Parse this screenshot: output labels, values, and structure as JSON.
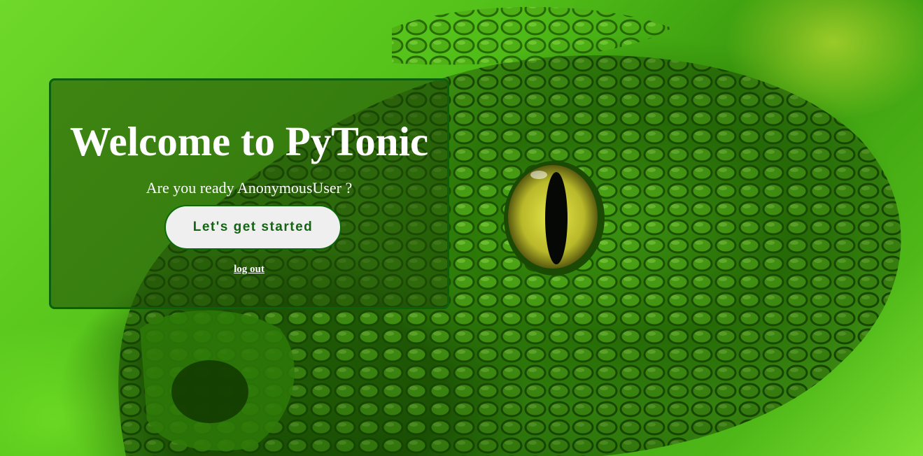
{
  "background": {
    "image": "green-snake-photo"
  },
  "card": {
    "title": "Welcome to PyTonic",
    "greeting": "Are you ready AnonymousUser ?",
    "start_button_label": "Let's get started",
    "logout_link_label": "log out"
  },
  "colors": {
    "card_border": "#0c5f0c",
    "button_text": "#156315",
    "button_bg": "#efefef"
  }
}
